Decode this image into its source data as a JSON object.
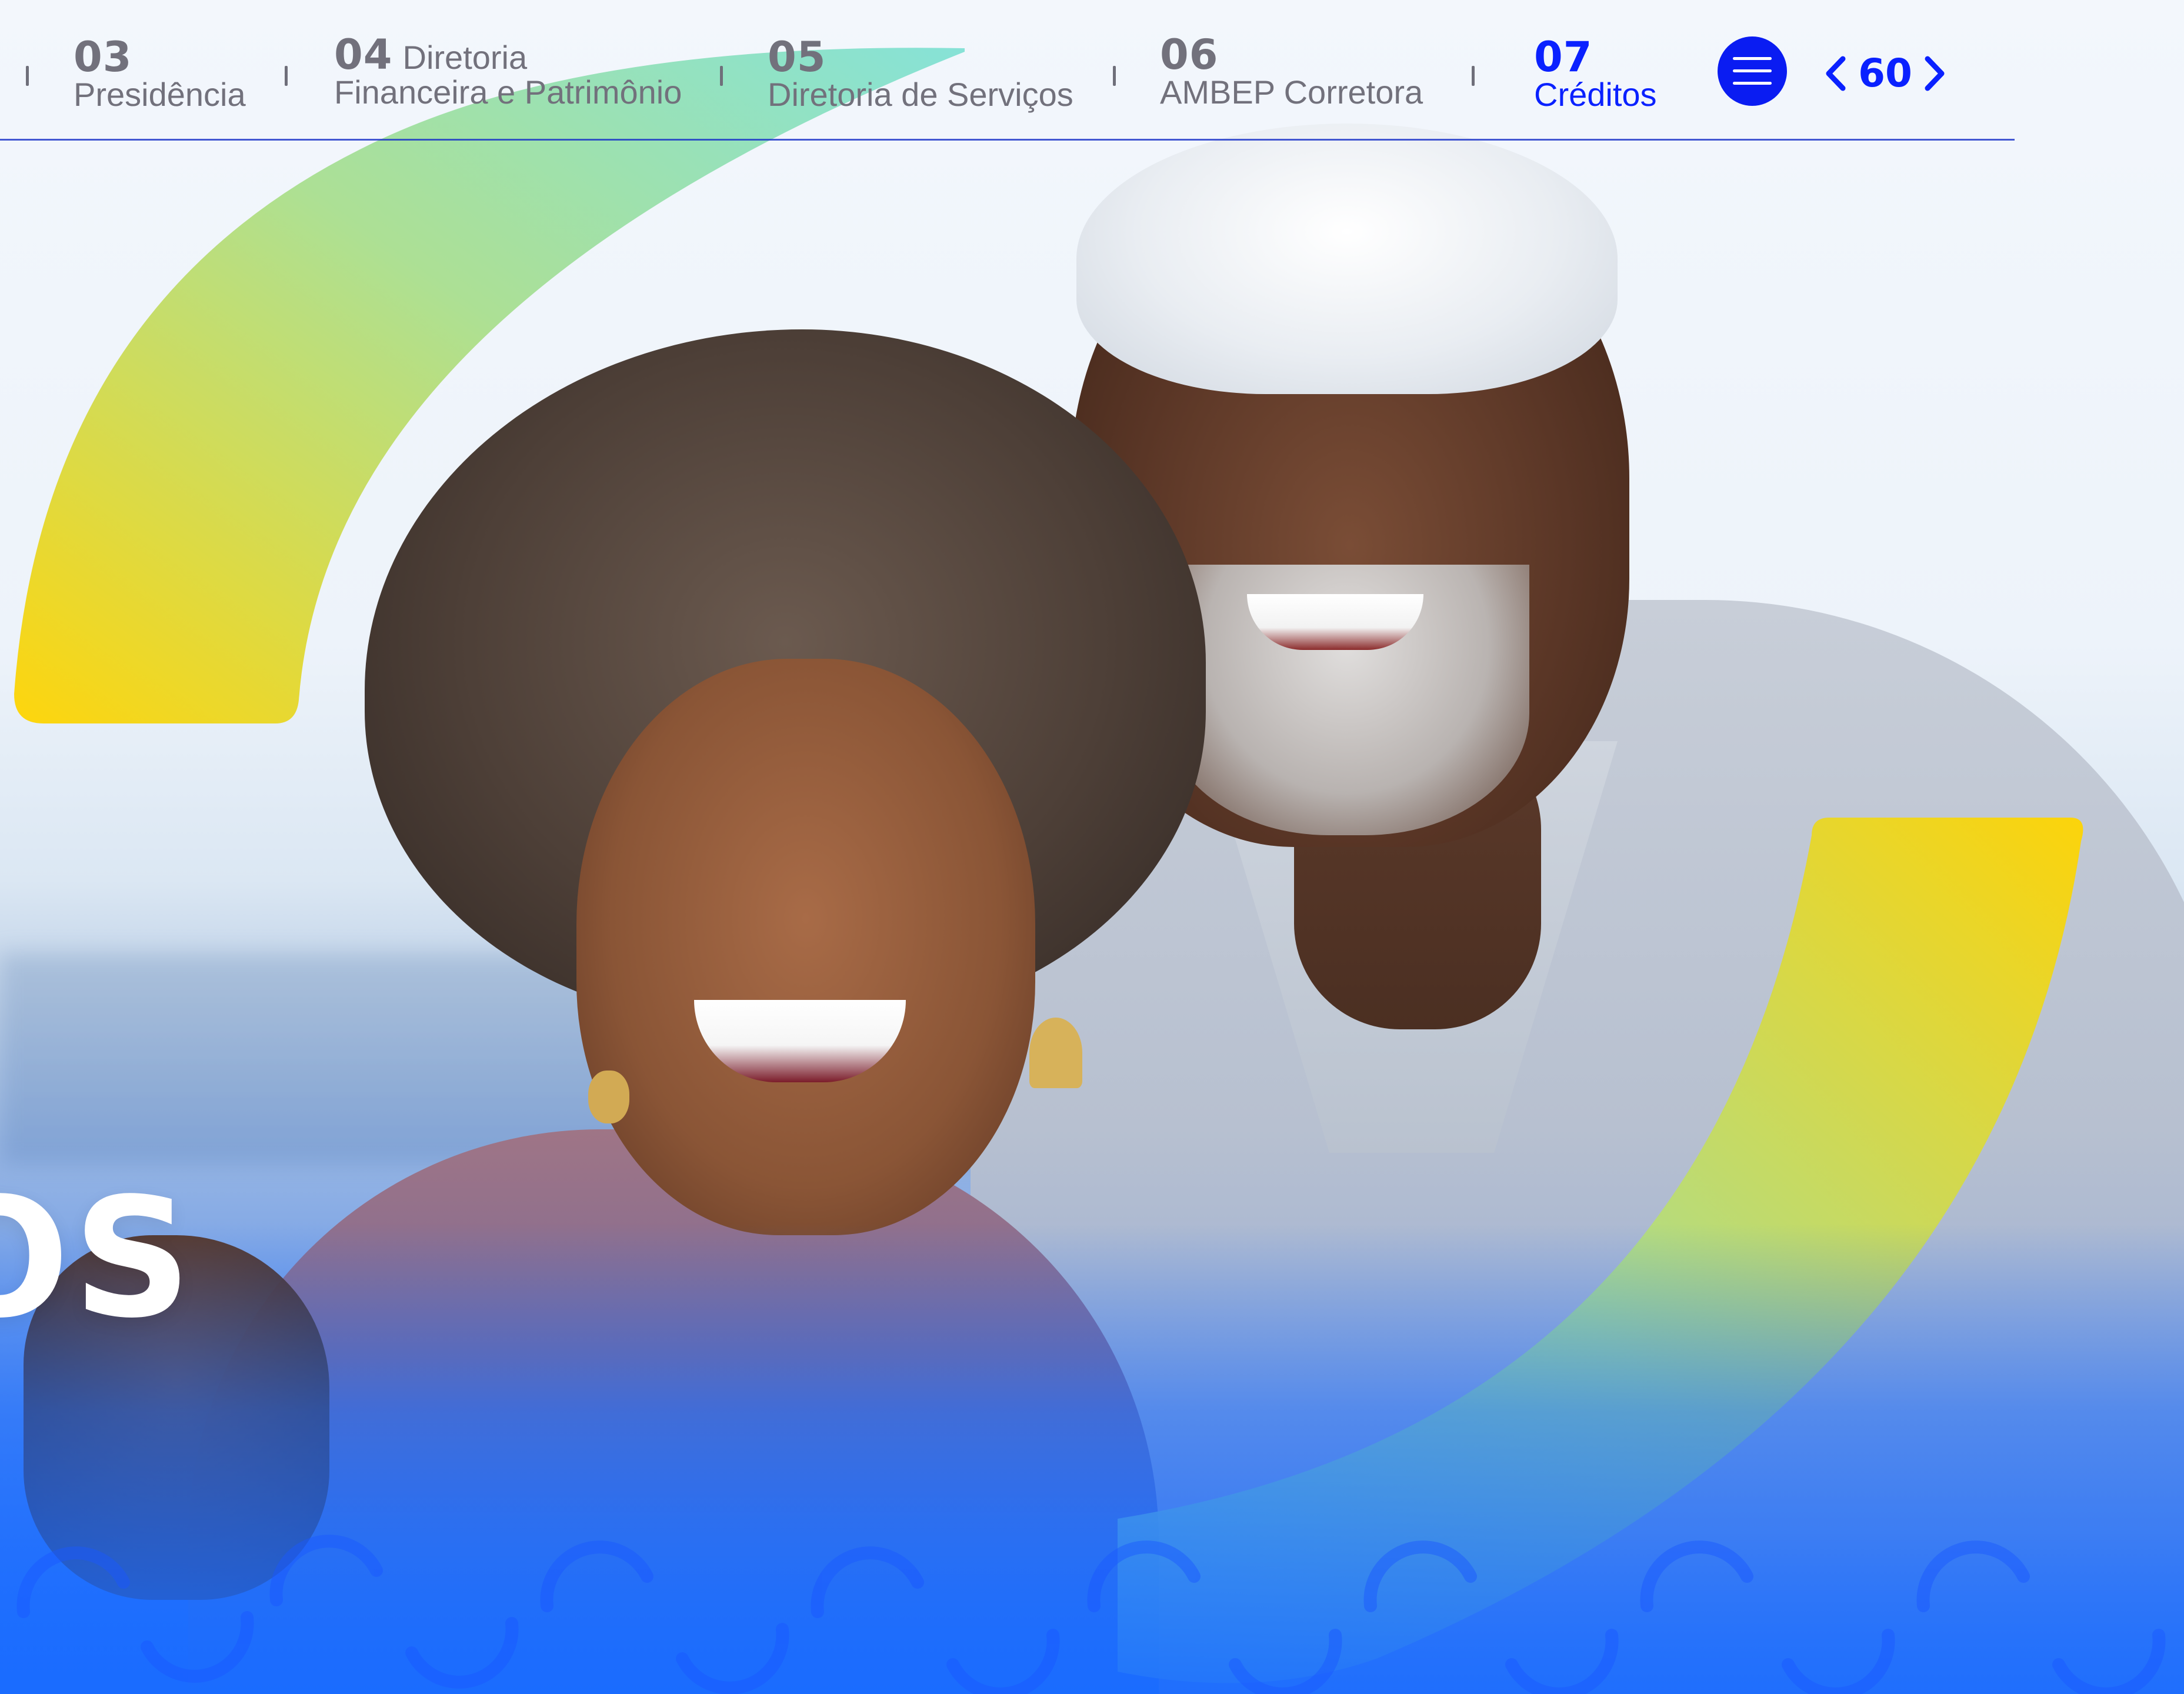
{
  "nav": {
    "items": [
      {
        "num": "03",
        "label": "Presidência"
      },
      {
        "num": "04",
        "label_line1": "Diretoria",
        "label_line2": "Financeira e Patrimônio"
      },
      {
        "num": "05",
        "label": "Diretoria de Serviços"
      },
      {
        "num": "06",
        "label": "AMBEP Corretora"
      },
      {
        "num": "07",
        "label": "Créditos",
        "active": true
      }
    ]
  },
  "pager": {
    "page": "60",
    "prev_icon": "chevron-left-icon",
    "next_icon": "chevron-right-icon"
  },
  "menu": {
    "icon": "hamburger-icon"
  },
  "hero": {
    "big_word_visible_part": "OS"
  },
  "colors": {
    "accent_blue": "#0a21ff",
    "nav_gray": "#72717c",
    "yellow": "#ffd400",
    "mint": "#7be0d3",
    "bottom_blue": "#1a6cff"
  }
}
